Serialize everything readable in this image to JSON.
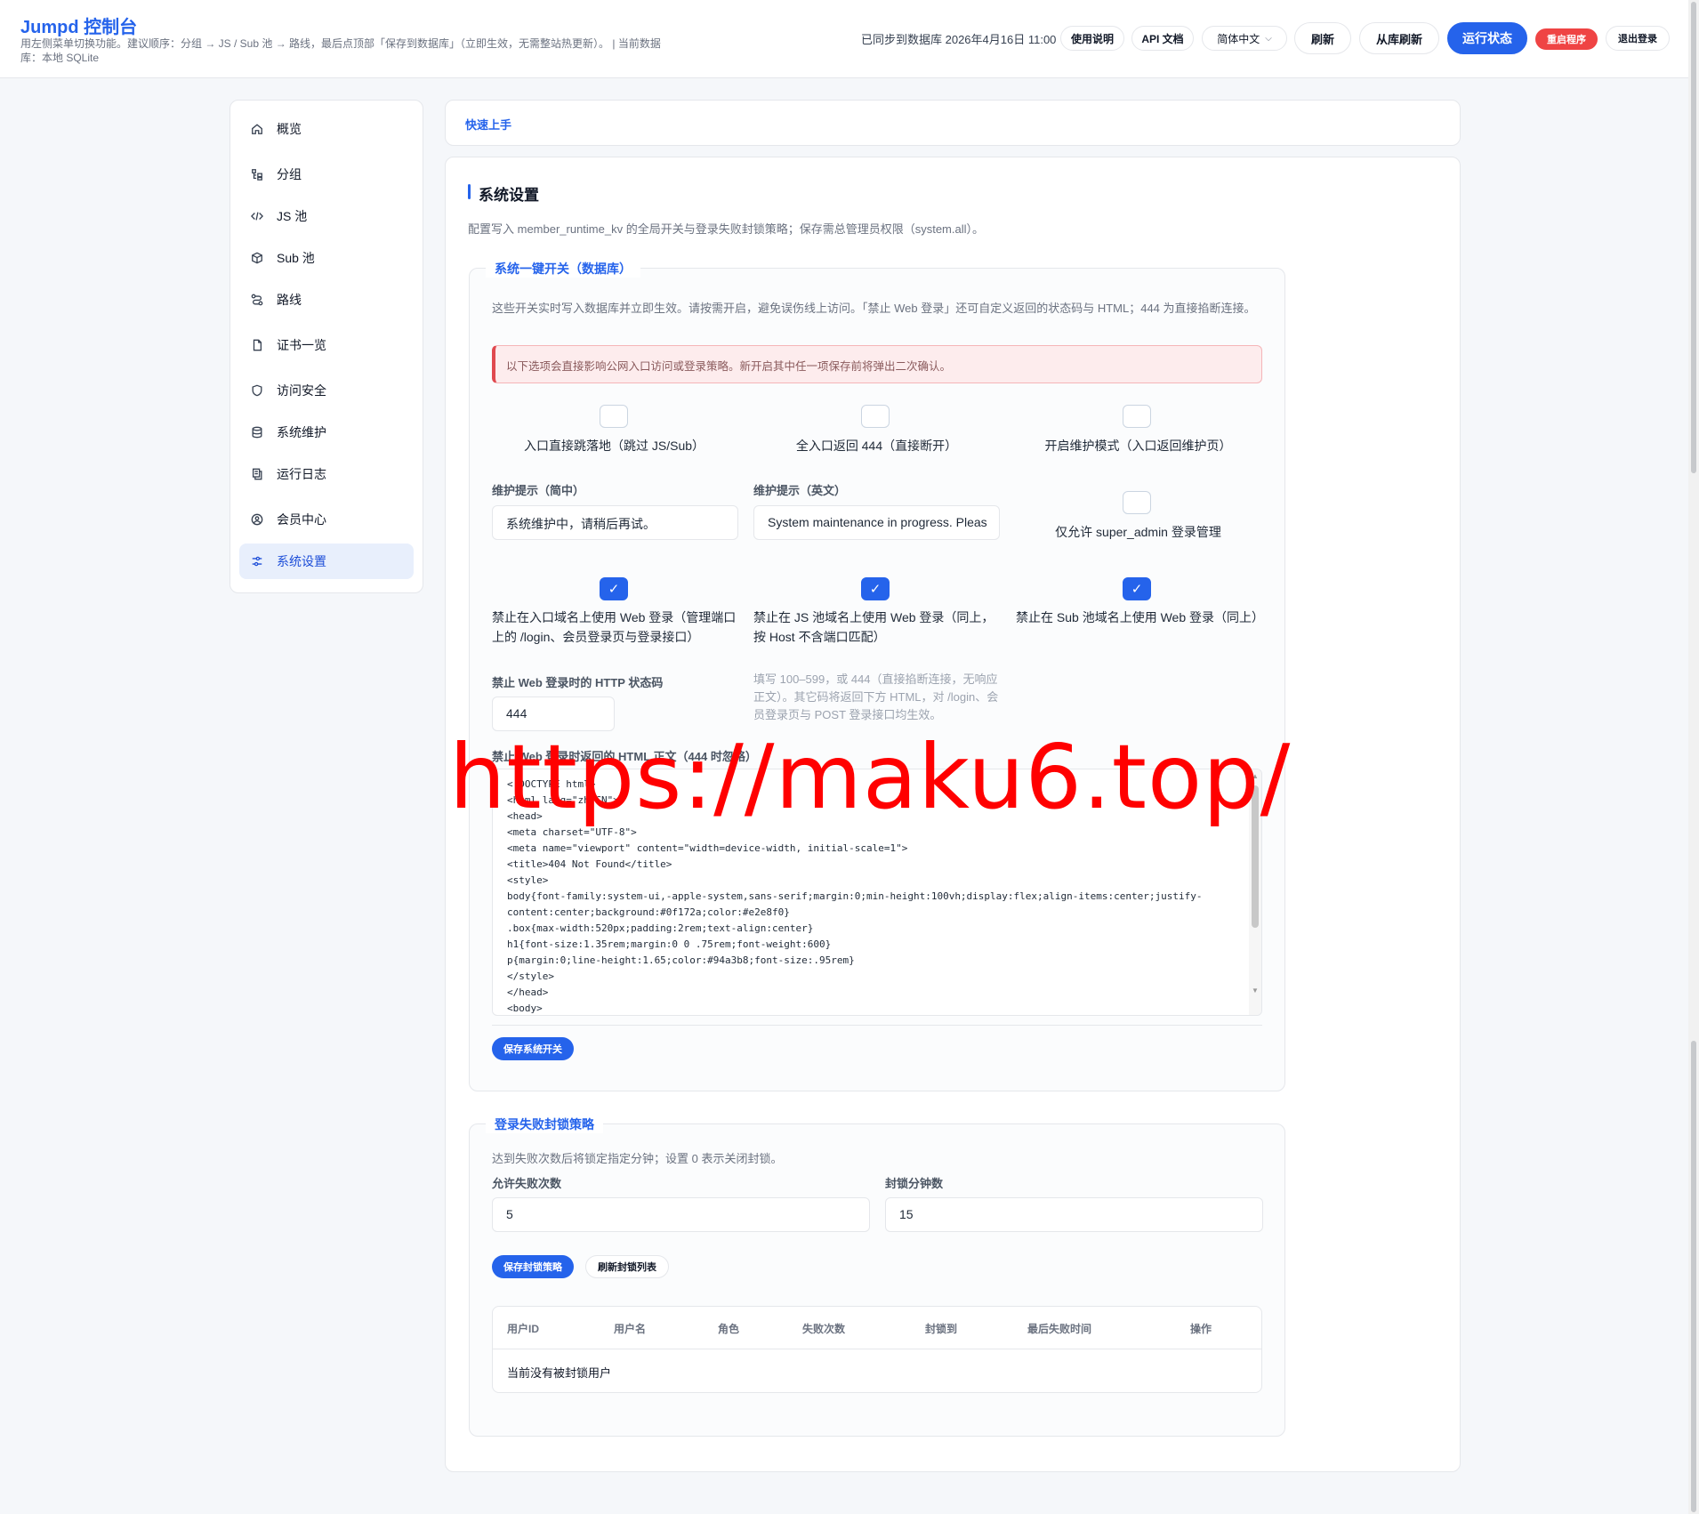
{
  "header": {
    "brand": "Jumpd 控制台",
    "subtitle": "用左侧菜单切换功能。建议顺序：分组 → JS / Sub 池 → 路线，最后点顶部「保存到数据库」（立即生效，无需整站热更新）。 | 当前数据库：本地 SQLite",
    "sync_status": "已同步到数据库 2026年4月16日 11:00",
    "buttons": {
      "usage": "使用说明",
      "api_docs": "API 文档",
      "language": "简体中文",
      "refresh": "刷新",
      "refresh_from_db": "从库刷新",
      "run_status": "运行状态",
      "restart": "重启程序",
      "logout": "退出登录"
    }
  },
  "sidebar": {
    "items": [
      {
        "label": "概览",
        "icon": "home-icon"
      },
      {
        "label": "分组",
        "icon": "group-icon"
      },
      {
        "label": "JS 池",
        "icon": "code-icon"
      },
      {
        "label": "Sub 池",
        "icon": "box-icon"
      },
      {
        "label": "路线",
        "icon": "route-icon"
      },
      {
        "label": "证书一览",
        "icon": "certificate-icon"
      },
      {
        "label": "访问安全",
        "icon": "shield-icon"
      },
      {
        "label": "系统维护",
        "icon": "database-icon"
      },
      {
        "label": "运行日志",
        "icon": "log-icon"
      },
      {
        "label": "会员中心",
        "icon": "user-circle-icon"
      },
      {
        "label": "系统设置",
        "icon": "settings-sliders-icon",
        "active": true
      }
    ]
  },
  "quickstart": {
    "label": "快速上手"
  },
  "settings": {
    "title": "系统设置",
    "description": "配置写入 member_runtime_kv 的全局开关与登录失败封锁策略；保存需总管理员权限（system.all）。",
    "switches_section": {
      "legend": "系统一键开关（数据库）",
      "description": "这些开关实时写入数据库并立即生效。请按需开启，避免误伤线上访问。「禁止 Web 登录」还可自定义返回的状态码与 HTML；444 为直接掐断连接。",
      "alert": "以下选项会直接影响公网入口访问或登录策略。新开启其中任一项保存前将弹出二次确认。",
      "toggles": {
        "direct_landing": {
          "label": "入口直接跳落地（跳过 JS/Sub）",
          "checked": false
        },
        "all_444": {
          "label": "全入口返回 444（直接断开）",
          "checked": false
        },
        "maintenance": {
          "label": "开启维护模式（入口返回维护页）",
          "checked": false
        },
        "super_admin_only": {
          "label": "仅允许 super_admin 登录管理",
          "checked": false
        },
        "block_entry_login": {
          "label": "禁止在入口域名上使用 Web 登录（管理端口上的 /login、会员登录页与登录接口）",
          "checked": true
        },
        "block_js_login": {
          "label": "禁止在 JS 池域名上使用 Web 登录（同上，按 Host 不含端口匹配）",
          "checked": true
        },
        "block_sub_login": {
          "label": "禁止在 Sub 池域名上使用 Web 登录（同上）",
          "checked": true
        }
      },
      "maint_zh_label": "维护提示（简中）",
      "maint_zh_value": "系统维护中，请稍后再试。",
      "maint_en_label": "维护提示（英文）",
      "maint_en_value": "System maintenance in progress. Pleas",
      "status_code_label": "禁止 Web 登录时的 HTTP 状态码",
      "status_code_value": "444",
      "status_code_hint": "填写 100–599，或 444（直接掐断连接，无响应正文）。其它码将返回下方 HTML，对 /login、会员登录页与 POST 登录接口均生效。",
      "html_label": "禁止 Web 登录时返回的 HTML 正文（444 时忽略）",
      "html_body": "<!DOCTYPE html>\n<html lang=\"zh-CN\">\n<head>\n<meta charset=\"UTF-8\">\n<meta name=\"viewport\" content=\"width=device-width, initial-scale=1\">\n<title>404 Not Found</title>\n<style>\nbody{font-family:system-ui,-apple-system,sans-serif;margin:0;min-height:100vh;display:flex;align-items:center;justify-content:center;background:#0f172a;color:#e2e8f0}\n.box{max-width:520px;padding:2rem;text-align:center}\nh1{font-size:1.35rem;margin:0 0 .75rem;font-weight:600}\np{margin:0;line-height:1.65;color:#94a3b8;font-size:.95rem}\n</style>\n</head>\n<body>",
      "save_button": "保存系统开关"
    },
    "lockout_section": {
      "legend": "登录失败封锁策略",
      "description": "达到失败次数后将锁定指定分钟；设置 0 表示关闭封锁。",
      "max_fail_label": "允许失败次数",
      "max_fail_value": "5",
      "lock_minutes_label": "封锁分钟数",
      "lock_minutes_value": "15",
      "save_button": "保存封锁策略",
      "refresh_button": "刷新封锁列表",
      "table": {
        "headers": [
          "用户ID",
          "用户名",
          "角色",
          "失败次数",
          "封锁到",
          "最后失败时间",
          "操作"
        ],
        "empty": "当前没有被封锁用户"
      }
    }
  },
  "watermark": "https://maku6.top/",
  "colors": {
    "accent": "#2563eb",
    "danger": "#ef4444",
    "watermark": "#ff0000"
  }
}
